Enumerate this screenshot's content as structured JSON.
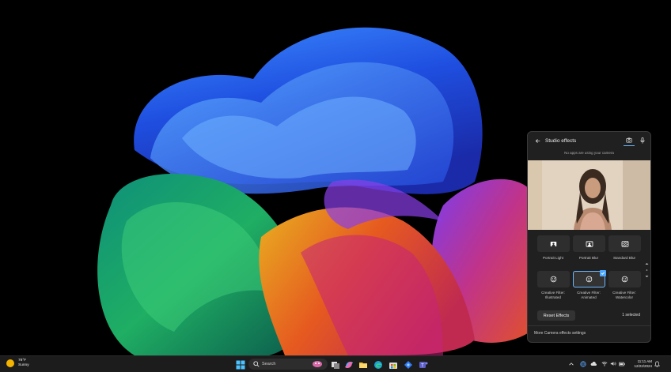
{
  "studio_effects": {
    "title": "Studio effects",
    "camera_status": "No apps are using your camera",
    "effects": [
      {
        "label": "Portrait Light",
        "icon": "portrait-light-icon",
        "selected": false
      },
      {
        "label": "Portrait Blur",
        "icon": "portrait-blur-icon",
        "selected": false
      },
      {
        "label": "Standard Blur",
        "icon": "standard-blur-icon",
        "selected": false
      },
      {
        "label": "Creative Filter: Illustrated",
        "icon": "creative-filter-icon",
        "selected": false
      },
      {
        "label": "Creative Filter: Animated",
        "icon": "creative-filter-icon",
        "selected": true
      },
      {
        "label": "Creative Filter: Watercolor",
        "icon": "creative-filter-icon",
        "selected": false
      }
    ],
    "reset_label": "Reset Effects",
    "selected_count": "1 selected",
    "more_settings": "More Camera effects settings",
    "accent_color": "#4ea8ff"
  },
  "taskbar": {
    "weather": {
      "temp": "78°F",
      "condition": "Sunny"
    },
    "search_placeholder": "Search",
    "clock": {
      "time": "11:11 AM",
      "date": "12/22/2024"
    }
  }
}
